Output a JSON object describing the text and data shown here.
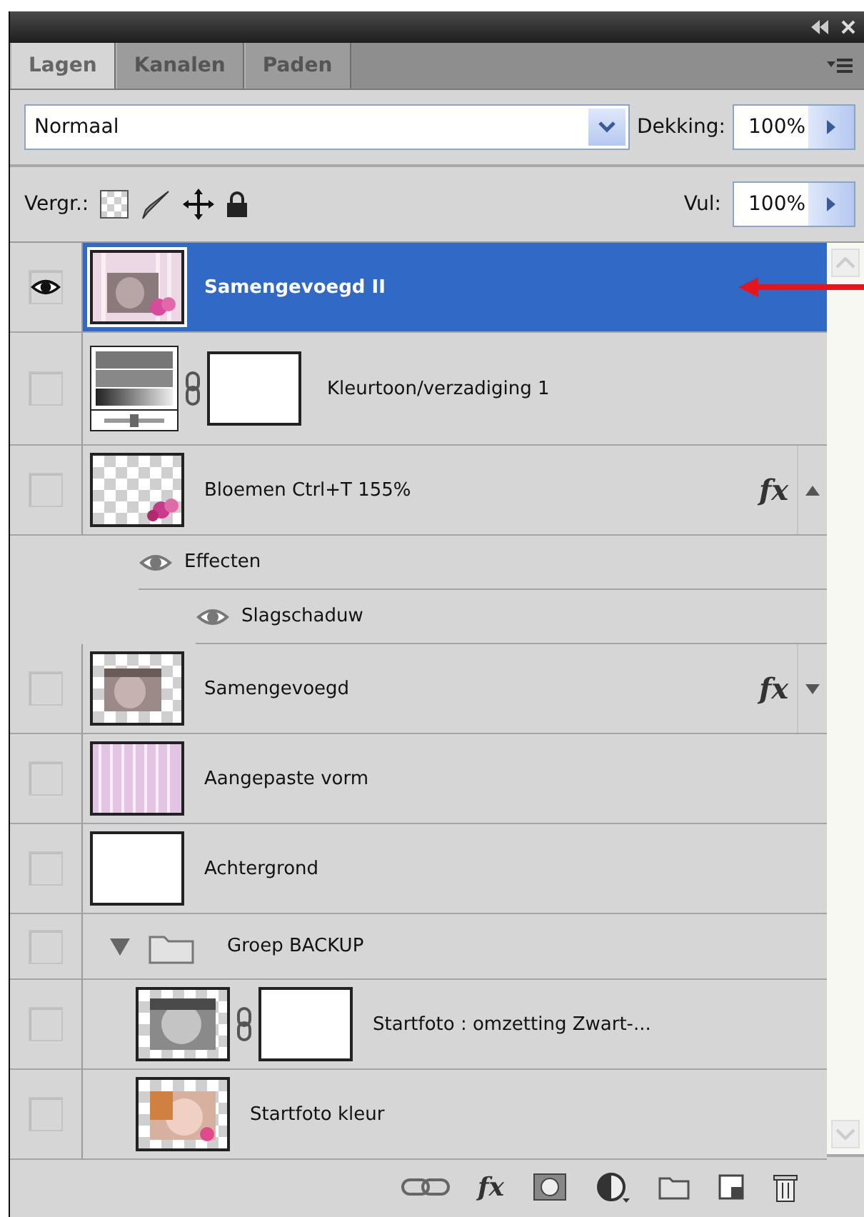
{
  "tabs": [
    {
      "label": "Lagen",
      "selected": true
    },
    {
      "label": "Kanalen",
      "selected": false
    },
    {
      "label": "Paden",
      "selected": false
    }
  ],
  "blend_mode": {
    "value": "Normaal"
  },
  "opacity": {
    "label": "Dekking:",
    "value": "100%"
  },
  "lock": {
    "label": "Vergr.:"
  },
  "fill": {
    "label": "Vul:",
    "value": "100%"
  },
  "layers": [
    {
      "kind": "layer",
      "name": "Samengevoegd II",
      "thumb": {
        "kind": "merged"
      },
      "visible": true,
      "selected": true,
      "pointed": true
    },
    {
      "kind": "adjustment",
      "name": "Kleurtoon/verzadiging 1",
      "thumb": {
        "kind": "adjustment"
      },
      "visible": false,
      "selected": false
    },
    {
      "kind": "layer",
      "name": "Bloemen Ctrl+T 155%",
      "thumb": {
        "kind": "flowers"
      },
      "visible": false,
      "selected": false,
      "fx": {
        "label": "fx",
        "expanded": true
      },
      "children": [
        {
          "kind": "effect",
          "name": "Effecten",
          "visible": true,
          "children": [
            {
              "kind": "effect",
              "name": "Slagschaduw",
              "visible": true
            }
          ]
        }
      ]
    },
    {
      "kind": "layer",
      "name": "Samengevoegd",
      "visible": false,
      "selected": false,
      "fx": {
        "label": "fx",
        "expanded": false
      }
    },
    {
      "kind": "layer",
      "name": "Aangepaste vorm",
      "thumb": {
        "kind": "pattern"
      },
      "visible": false,
      "selected": false
    },
    {
      "kind": "layer",
      "name": "Achtergrond",
      "thumb": {
        "kind": "white"
      },
      "visible": false,
      "selected": false
    },
    {
      "kind": "group",
      "name": "Groep BACKUP",
      "visible": false,
      "selected": false,
      "expanded": true,
      "children": [
        {
          "kind": "masked",
          "name": "Startfoto : omzetting Zwart-...",
          "thumb": {
            "kind": "bw"
          },
          "visible": false,
          "selected": false
        },
        {
          "kind": "layer",
          "name": "Startfoto kleur",
          "thumb": {
            "kind": "color"
          },
          "visible": false,
          "selected": false
        }
      ]
    }
  ],
  "footer": {
    "fx_label": "fx"
  }
}
